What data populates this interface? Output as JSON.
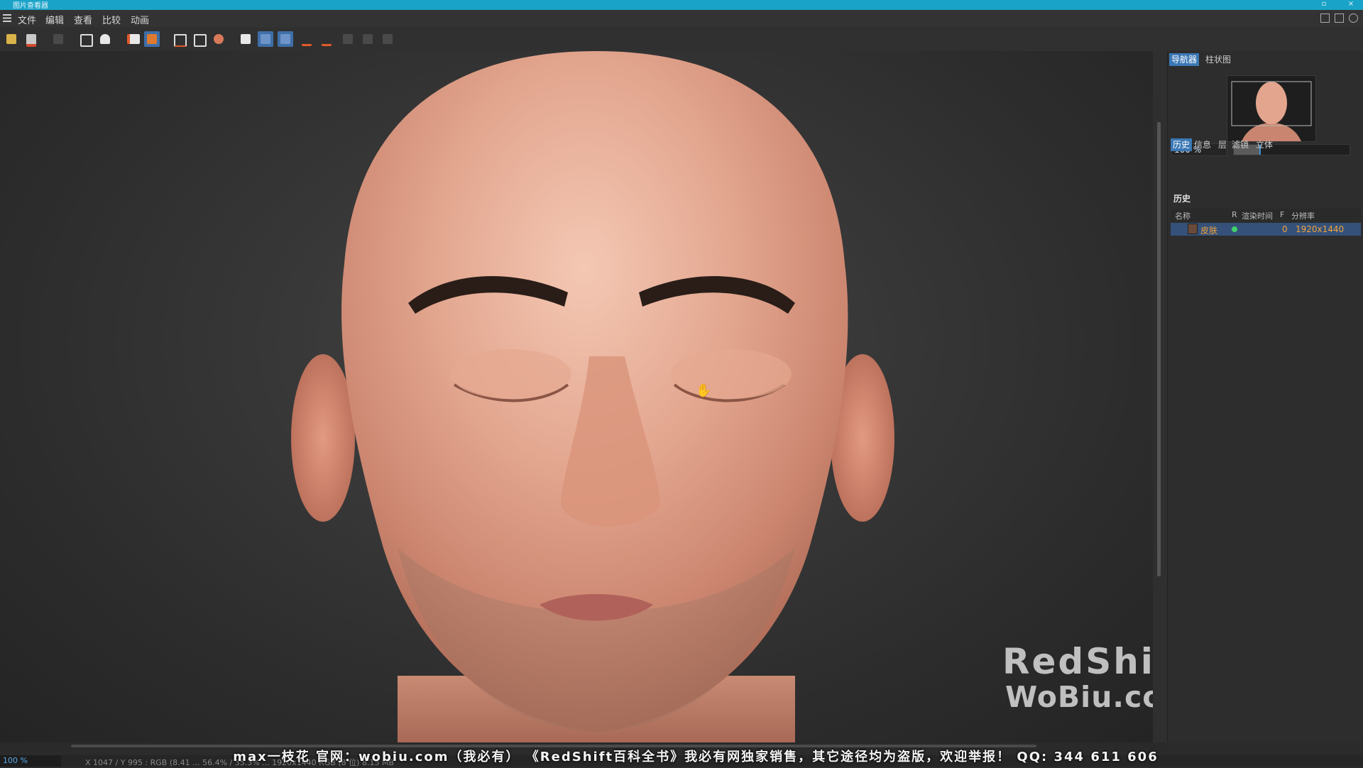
{
  "window": {
    "title": "图片查看器"
  },
  "menu": [
    "文件",
    "编辑",
    "查看",
    "比较",
    "动画"
  ],
  "navigator": {
    "tabs": [
      "导航器",
      "柱状图"
    ],
    "zoom": "100 %",
    "zoom_slider_level": 0.22
  },
  "info_tabs": [
    "历史",
    "信息",
    "层",
    "滤镜",
    "立体"
  ],
  "history": {
    "title": "历史",
    "columns": [
      "名称",
      "R",
      "渲染时间",
      "F",
      "分辨率"
    ],
    "rows": [
      {
        "name": "皮肤",
        "frame": "0",
        "resolution": "1920x1440"
      }
    ]
  },
  "watermark": {
    "line1": "RedShift百科全书",
    "line2": "WoBiu.com  max一枝花"
  },
  "status": {
    "zoom": "100 %",
    "text": "X 1047 / Y 995 : RGB (8.41 ... 56.4% / 35.3% ... 1920x1440 RGB (8 位) 8.15 MB"
  },
  "banner": "max一枝花 官网：wobiu.com（我必有）  《RedShift百科全书》我必有网独家销售，其它途径均为盗版，欢迎举报！  QQ: 344 611 606",
  "colors": {
    "titlebar": "#1aa3c8",
    "accent": "#3b78b5",
    "active_text": "#f2a33a",
    "status_dot": "#3fd16a"
  }
}
